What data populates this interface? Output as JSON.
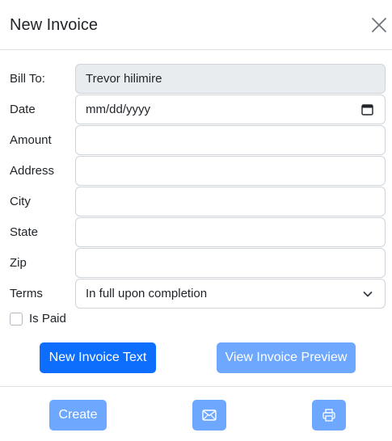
{
  "header": {
    "title": "New Invoice",
    "close_icon": "close-icon"
  },
  "form": {
    "bill_to": {
      "label": "Bill To:",
      "value": "Trevor hilimire"
    },
    "date": {
      "label": "Date",
      "placeholder": "mm/dd/yyyy",
      "icon": "calendar-icon"
    },
    "amount": {
      "label": "Amount",
      "value": ""
    },
    "address": {
      "label": "Address",
      "value": ""
    },
    "city": {
      "label": "City",
      "value": ""
    },
    "state": {
      "label": "State",
      "value": ""
    },
    "zip": {
      "label": "Zip",
      "value": ""
    },
    "terms": {
      "label": "Terms",
      "selected": "In full upon completion",
      "icon": "chevron-down-icon"
    },
    "is_paid": {
      "label": "Is Paid",
      "checked": false
    }
  },
  "actions": {
    "new_invoice_text": "New Invoice Text",
    "view_invoice_preview": "View Invoice Preview"
  },
  "footer": {
    "create": "Create",
    "email_icon": "envelope-icon",
    "print_icon": "printer-icon"
  },
  "colors": {
    "primary": "#0d6efd",
    "primary_light": "#6ea8fe",
    "readonly_bg": "#e9ecef",
    "border": "#ced4da",
    "divider": "#dee2e6"
  }
}
